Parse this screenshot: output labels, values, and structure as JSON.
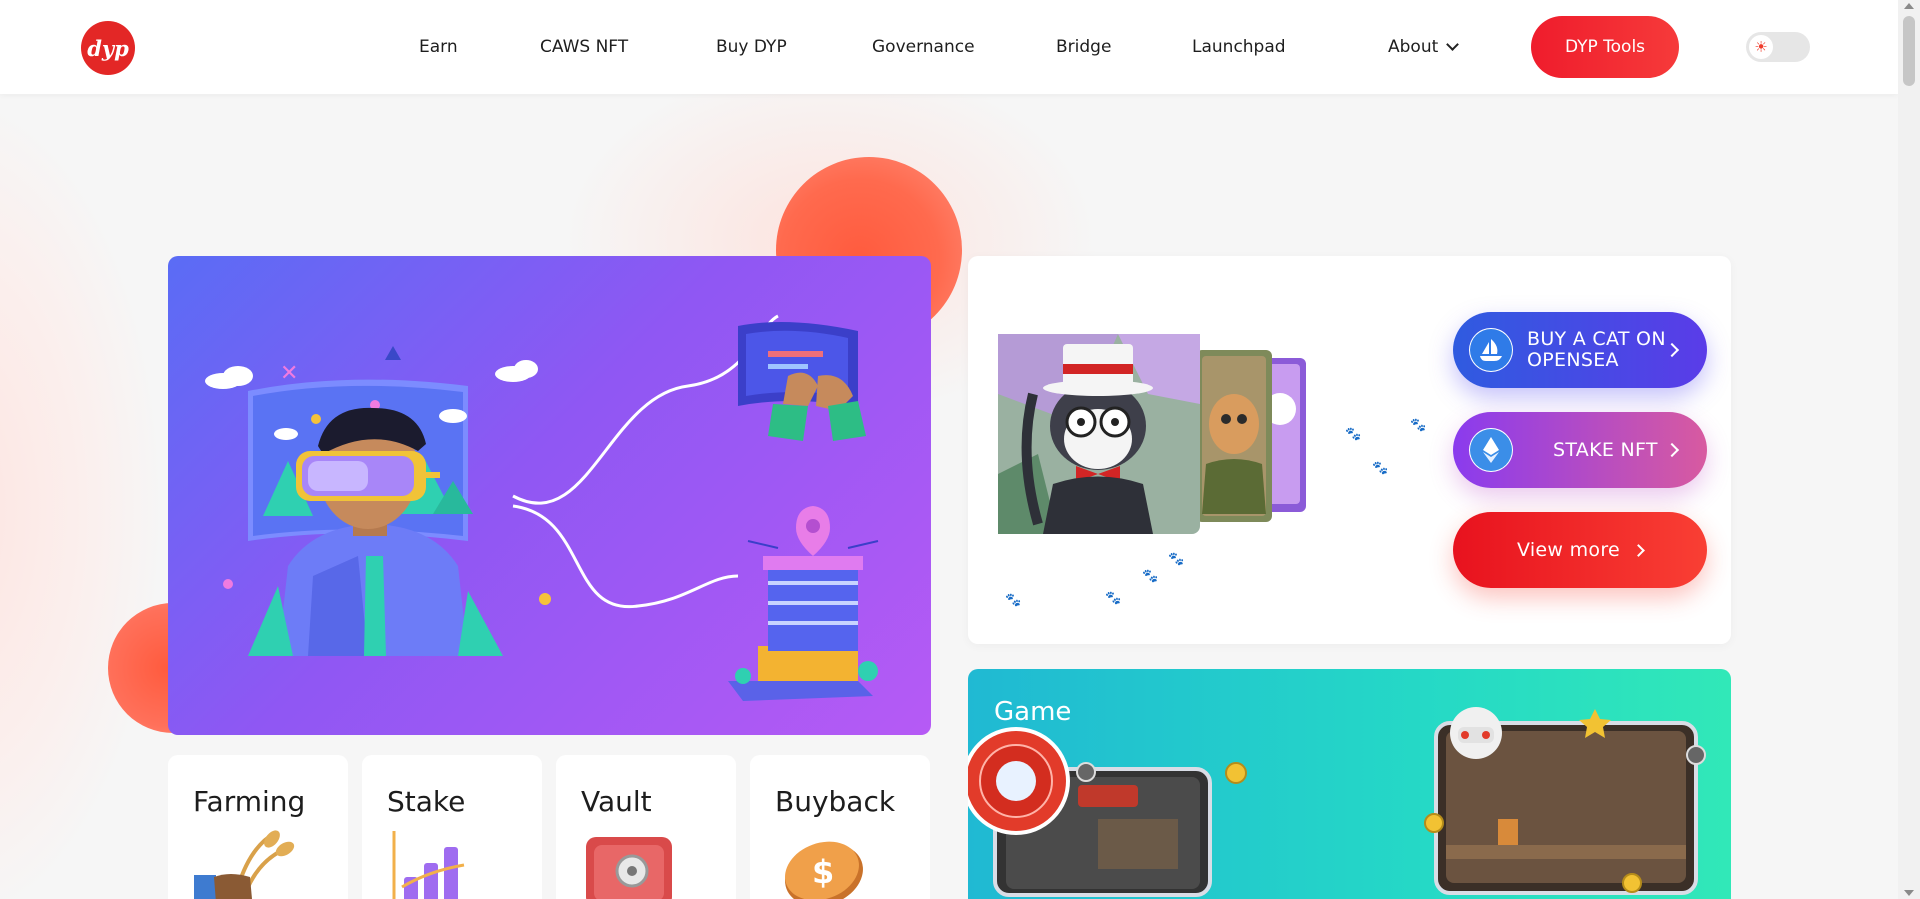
{
  "header": {
    "logo_text": "dyp",
    "nav": [
      {
        "label": "Earn"
      },
      {
        "label": "CAWS NFT"
      },
      {
        "label": "Buy DYP"
      },
      {
        "label": "Governance"
      },
      {
        "label": "Bridge"
      },
      {
        "label": "Launchpad"
      },
      {
        "label": "About"
      }
    ],
    "tools_button": "DYP Tools",
    "theme_toggle_icon": "sun-icon"
  },
  "nft_card": {
    "buttons": [
      {
        "label": "BUY A CAT ON OPENSEA",
        "icon": "opensea-icon"
      },
      {
        "label": "STAKE NFT",
        "icon": "ethereum-icon"
      },
      {
        "label": "View more",
        "icon": "chevron-right-icon"
      }
    ]
  },
  "game": {
    "title": "Game"
  },
  "features": [
    {
      "title": "Farming",
      "icon": "farming-icon"
    },
    {
      "title": "Stake",
      "icon": "stake-chart-icon"
    },
    {
      "title": "Vault",
      "icon": "vault-safe-icon"
    },
    {
      "title": "Buyback",
      "icon": "buyback-coin-icon"
    }
  ],
  "colors": {
    "brand_red": "#e32726",
    "hero_gradient_start": "#5a6cf5",
    "hero_gradient_end": "#b65af5",
    "game_gradient_start": "#20b9d3",
    "game_gradient_end": "#31e8b8"
  }
}
